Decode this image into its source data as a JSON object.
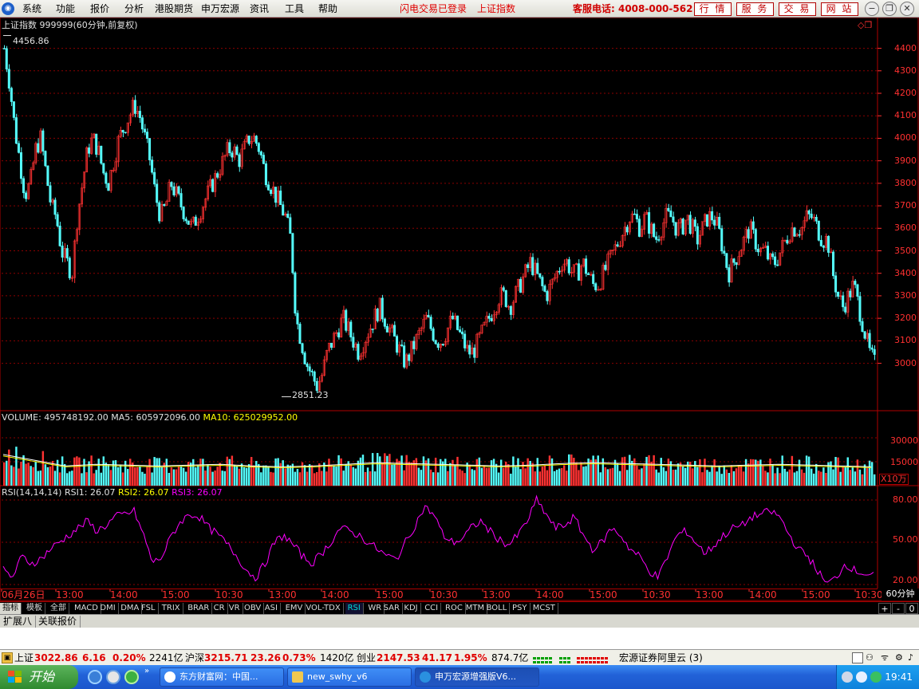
{
  "menu": {
    "items": [
      "系统",
      "功能",
      "报价",
      "分析",
      "港股期货",
      "申万宏源",
      "资讯",
      "工具",
      "帮助"
    ],
    "status_left": "闪电交易已登录",
    "status_right": "上证指数",
    "hotline": "客服电话: 4008-000-562",
    "nav_buttons": [
      "行 情",
      "服 务",
      "交 易",
      "网 站"
    ]
  },
  "chart_header": {
    "security": "上证指数 999999(60分钟,前复权)",
    "high_marker": "4456.86",
    "low_marker": "2851.23"
  },
  "volume": {
    "label": "VOLUME: 495748192.00",
    "ma5": "MA5: 605972096.00",
    "ma10": "MA10: 625029952.00",
    "ticks": [
      "30000",
      "15000"
    ],
    "unit": "X10万"
  },
  "rsi": {
    "label": "RSI(14,14,14)",
    "rsi1": "RSI1: 26.07",
    "rsi2": "RSI2: 26.07",
    "rsi3": "RSI3: 26.07",
    "ticks": [
      "80.00",
      "50.00",
      "20.00"
    ]
  },
  "x_axis": [
    "06月26日",
    "13:00",
    "14:00",
    "15:00",
    "10:30",
    "13:00",
    "14:00",
    "15:00",
    "10:30",
    "13:00",
    "14:00",
    "15:00",
    "10:30",
    "13:00",
    "14:00",
    "15:00",
    "10:30"
  ],
  "period": "60分钟",
  "indicator_tabs": [
    "指标",
    "模板",
    "全部",
    "MACD",
    "DMI",
    "DMA",
    "FSL",
    "TRIX",
    "BRAR",
    "CR",
    "VR",
    "OBV",
    "ASI",
    "EMV",
    "VOL-TDX",
    "RSI",
    "WR",
    "SAR",
    "KDJ",
    "CCI",
    "ROC",
    "MTM",
    "BOLL",
    "PSY",
    "MCST"
  ],
  "active_tab": "RSI",
  "tab_controls": [
    "+",
    "-",
    "0"
  ],
  "bottom_tabs": [
    "扩展八",
    "关联报价"
  ],
  "status_bar": {
    "sh_label": "上证",
    "sh_value": "3022.86",
    "sh_change": "6.16",
    "sh_pct": "0.20%",
    "sh_amount": "2241亿",
    "hs_label": "沪深",
    "hs_value": "3215.71",
    "hs_change": "23.26",
    "hs_pct": "0.73%",
    "hs_amount": "1420亿",
    "cy_label": "创业",
    "cy_value": "2147.53",
    "cy_change": "41.17",
    "cy_pct": "1.95%",
    "cy_amount": "874.7亿",
    "server": "宏源证券阿里云 (3)"
  },
  "taskbar": {
    "start": "开始",
    "tasks": [
      "东方财富网：中国...",
      "new_swhy_v6",
      "申万宏源增强版V6..."
    ],
    "clock": "19:41"
  },
  "colors": {
    "up": "#ff3232",
    "down": "#54fcfc",
    "ma5": "#ffffff",
    "ma10": "#ffff00",
    "rsi": "#ff00ff",
    "grid": "#8b0000"
  },
  "chart_data": {
    "type": "candlestick",
    "title": "上证指数 999999(60分钟,前复权)",
    "y_ticks": [
      4400,
      4300,
      4200,
      4100,
      4000,
      3900,
      3800,
      3700,
      3600,
      3500,
      3400,
      3300,
      3200,
      3100,
      3000
    ],
    "ylim": [
      2800,
      4480
    ],
    "high": 4456.86,
    "low": 2851.23,
    "close_path": [
      4400,
      4250,
      4050,
      3900,
      3750,
      3800,
      3950,
      4000,
      3850,
      3700,
      3650,
      3500,
      3450,
      3400,
      3650,
      3800,
      3950,
      4000,
      3950,
      3850,
      3800,
      3900,
      4000,
      4050,
      4100,
      4150,
      4100,
      4000,
      3900,
      3750,
      3650,
      3700,
      3800,
      3750,
      3700,
      3650,
      3600,
      3650,
      3700,
      3750,
      3800,
      3850,
      3900,
      3950,
      3950,
      3900,
      3950,
      4000,
      4000,
      3950,
      3850,
      3800,
      3750,
      3700,
      3650,
      3550,
      3200,
      3100,
      3000,
      2950,
      2900,
      2950,
      3050,
      3100,
      3150,
      3200,
      3150,
      3100,
      3050,
      3100,
      3150,
      3200,
      3250,
      3200,
      3150,
      3100,
      3050,
      3000,
      3050,
      3100,
      3150,
      3200,
      3150,
      3100,
      3100,
      3150,
      3200,
      3150,
      3100,
      3050,
      3050,
      3100,
      3150,
      3200,
      3250,
      3300,
      3300,
      3250,
      3300,
      3350,
      3400,
      3450,
      3400,
      3350,
      3300,
      3350,
      3400,
      3450,
      3450,
      3400,
      3400,
      3450,
      3400,
      3350,
      3350,
      3400,
      3450,
      3500,
      3550,
      3600,
      3650,
      3650,
      3600,
      3650,
      3600,
      3550,
      3600,
      3650,
      3650,
      3600,
      3600,
      3650,
      3600,
      3550,
      3600,
      3650,
      3650,
      3600,
      3500,
      3400,
      3450,
      3500,
      3550,
      3600,
      3550,
      3500,
      3500,
      3450,
      3450,
      3500,
      3550,
      3600,
      3600,
      3600,
      3650,
      3650,
      3600,
      3550,
      3550,
      3400,
      3300,
      3250,
      3300,
      3350,
      3250,
      3150,
      3050,
      3000
    ],
    "volume_ma_levels": [
      19000,
      15500,
      12000,
      13000,
      12500,
      12000,
      12500,
      13000,
      12000,
      11500,
      12000,
      13000,
      14000,
      13500,
      13000,
      12500,
      12000,
      12500,
      13500,
      14000,
      13500,
      13000,
      12500,
      12000,
      12500,
      13000,
      12500,
      12000,
      11500
    ],
    "rsi_path": [
      30,
      25,
      40,
      35,
      38,
      45,
      50,
      55,
      60,
      65,
      58,
      62,
      68,
      70,
      72,
      55,
      35,
      40,
      55,
      65,
      70,
      68,
      60,
      55,
      48,
      40,
      30,
      25,
      35,
      50,
      55,
      48,
      40,
      35,
      42,
      50,
      60,
      58,
      55,
      50,
      45,
      40,
      38,
      50,
      62,
      75,
      70,
      55,
      50,
      52,
      60,
      65,
      58,
      52,
      48,
      55,
      65,
      80,
      70,
      60,
      62,
      68,
      55,
      45,
      50,
      60,
      55,
      45,
      40,
      30,
      25,
      40,
      55,
      58,
      50,
      42,
      48,
      55,
      60,
      62,
      68,
      70,
      72,
      68,
      55,
      45,
      40,
      30,
      20,
      25,
      35,
      30,
      28,
      26
    ]
  }
}
